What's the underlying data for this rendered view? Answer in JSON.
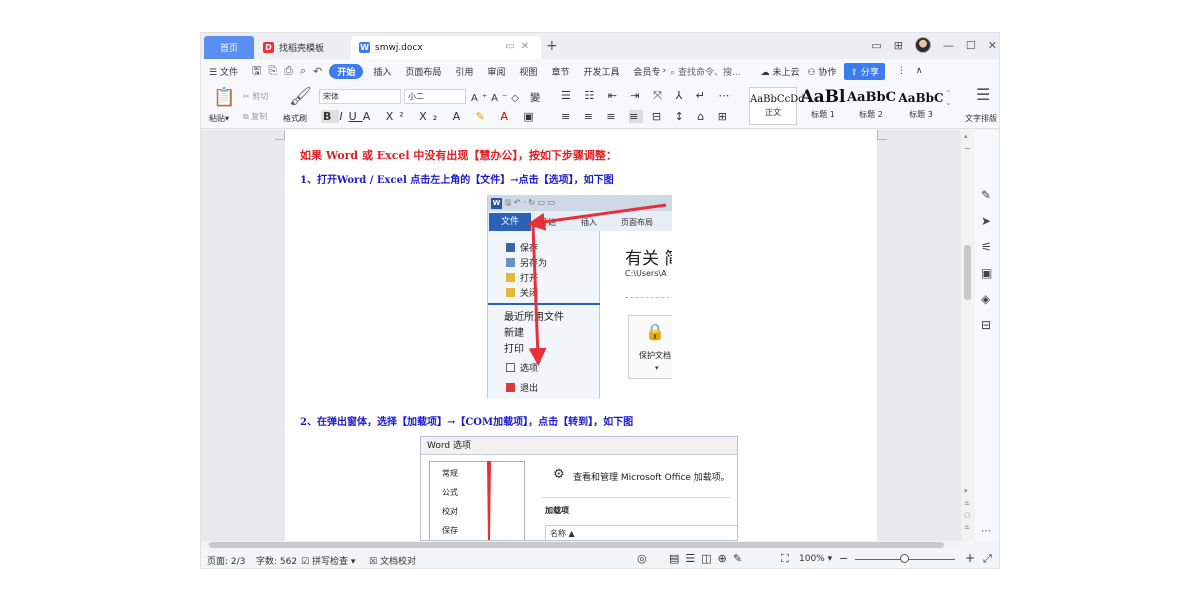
{
  "tabs": {
    "home": "首页",
    "template": "找稻壳模板",
    "document": "smwj.docx"
  },
  "menu": {
    "file": "文件",
    "start": "开始",
    "items": [
      "插入",
      "页面布局",
      "引用",
      "审阅",
      "视图",
      "章节",
      "开发工具",
      "会员专"
    ],
    "search": "查找命令、搜...",
    "cloud": "未上云",
    "collab": "协作",
    "share": "分享"
  },
  "ribbon": {
    "paste": "粘贴",
    "cut": "剪切",
    "copy": "复制",
    "format_painter": "格式刷",
    "font_name": "宋体",
    "font_size": "小二",
    "styles": [
      {
        "sample": "AaBbCcDd",
        "label": "正文"
      },
      {
        "sample": "AaBl",
        "label": "标题 1"
      },
      {
        "sample": "AaBbC",
        "label": "标题 2"
      },
      {
        "sample": "AaBbC",
        "label": "标题 3"
      }
    ],
    "text_layout": "文字排版"
  },
  "document": {
    "heading": "如果 Word 或 Excel 中没有出现【慧办公】，按如下步骤调整：",
    "step1": "1、打开Word / Excel 点击左上角的【文件】→点击【选项】，如下图",
    "step2": "2、在弹出窗体，选择【加载项】→【COM加载项】，点击【转到】，如下图",
    "shot1": {
      "file_tab": "文件",
      "tab_start": "开始",
      "tab_insert": "插入",
      "tab_layout": "页面布局",
      "items": [
        "保存",
        "另存为",
        "打开",
        "关闭"
      ],
      "recent": "最近所用文件",
      "new": "新建",
      "print": "打印",
      "options": "选项",
      "exit": "退出",
      "about": "有关 简",
      "path": "C:\\Users\\A",
      "protect": "保护文档"
    },
    "shot2": {
      "title": "Word 选项",
      "list": [
        "常规",
        "公式",
        "校对",
        "保存"
      ],
      "manage": "查看和管理 Microsoft Office 加载项。",
      "addins": "加载项",
      "name_header": "名称 ▲"
    }
  },
  "status": {
    "page": "页面: 2/3",
    "words": "字数: 562",
    "spell": "拼写检查",
    "proof": "文档校对",
    "zoom": "100%"
  },
  "colors": {
    "accent": "#3d7cf0",
    "heading_red": "#e02020",
    "step_blue": "#1a1ad0",
    "arrow_red": "#e8303a"
  }
}
